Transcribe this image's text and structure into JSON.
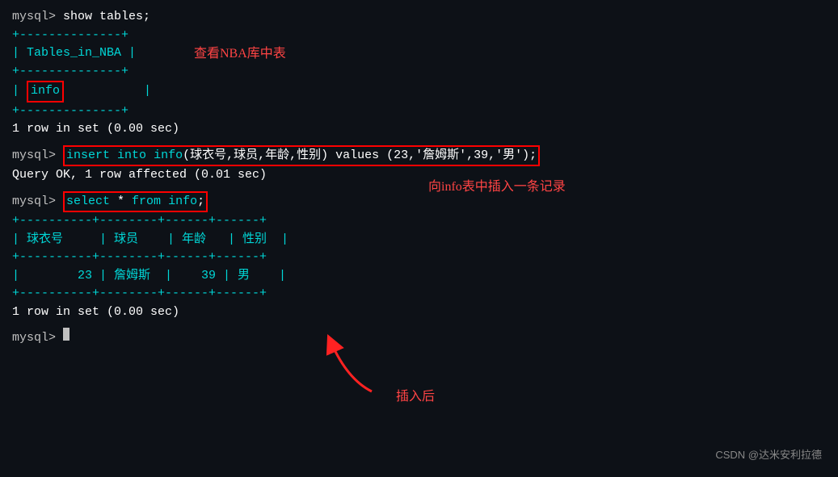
{
  "terminal": {
    "background": "#0d1117",
    "lines": [
      {
        "type": "command",
        "prompt": "mysql> ",
        "code": "show tables;"
      },
      {
        "type": "table-border",
        "content": "+--------------+"
      },
      {
        "type": "table-row",
        "content": "| Tables_in_NBA |"
      },
      {
        "type": "table-border",
        "content": "+--------------+"
      },
      {
        "type": "table-data-info",
        "content": "| info           |"
      },
      {
        "type": "table-border",
        "content": "+--------------+"
      },
      {
        "type": "result",
        "content": "1 row in set (0.00 sec)"
      },
      {
        "type": "blank"
      },
      {
        "type": "command-insert",
        "prompt": "mysql> ",
        "code": "insert into info(球衣号,球员,年龄,性别) values (23,'詹姆斯',39,'男');"
      },
      {
        "type": "result",
        "content": "Query OK, 1 row affected (0.01 sec)"
      },
      {
        "type": "blank"
      },
      {
        "type": "command-select",
        "prompt": "mysql> ",
        "code": "select * from info;"
      },
      {
        "type": "table-border2",
        "content": "+--------+--------+------+------+"
      },
      {
        "type": "table-header",
        "content": "| 球衣号  | 球员    | 年龄  | 性别  |"
      },
      {
        "type": "table-border2",
        "content": "+--------+--------+------+------+"
      },
      {
        "type": "table-data",
        "content": "|      23 | 詹姆斯  |   39 | 男    |"
      },
      {
        "type": "table-border2",
        "content": "+--------+--------+------+------+"
      },
      {
        "type": "result",
        "content": "1 row in set (0.00 sec)"
      },
      {
        "type": "blank"
      },
      {
        "type": "prompt-only",
        "content": "mysql> "
      }
    ]
  },
  "annotations": {
    "nba_tables": "查看NBA库中表",
    "insert_record": "向info表中插入一条记录",
    "after_insert": "插入后"
  },
  "watermark": "CSDN @达米安利拉德"
}
